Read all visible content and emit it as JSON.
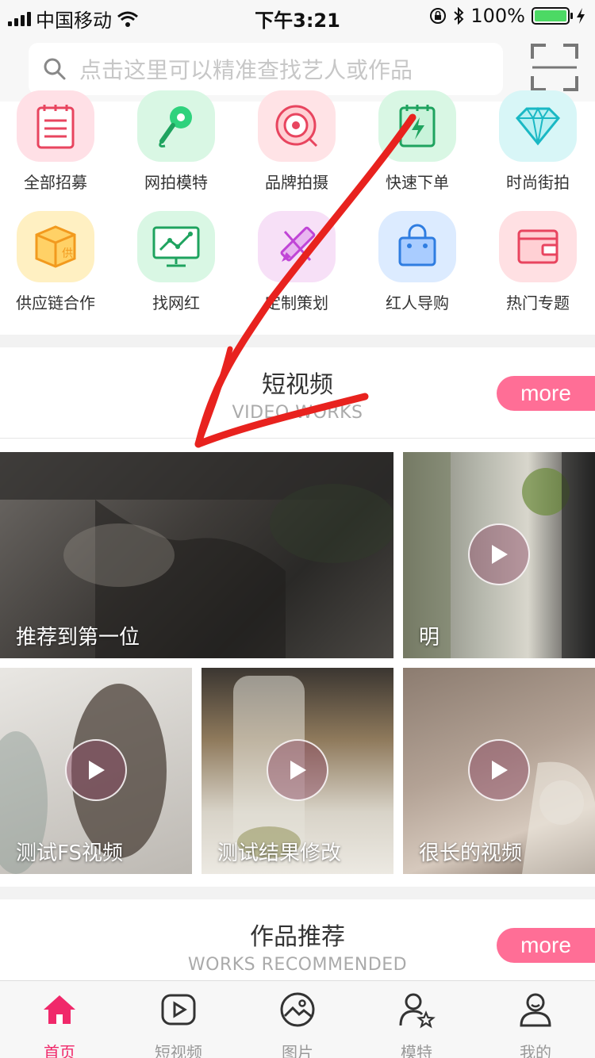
{
  "status_bar": {
    "carrier": "中国移动",
    "time": "下午3:21",
    "battery": "100%"
  },
  "search": {
    "placeholder": "点击这里可以精准查找艺人或作品"
  },
  "categories": [
    {
      "label": "全部招募",
      "icon": "recruit-icon",
      "bg": "#ffe0e6"
    },
    {
      "label": "网拍模特",
      "icon": "microphone-icon",
      "bg": "#d9f7e4"
    },
    {
      "label": "品牌拍摄",
      "icon": "camera-lens-icon",
      "bg": "#ffe3e6"
    },
    {
      "label": "快速下单",
      "icon": "quick-order-icon",
      "bg": "#d9f7e4"
    },
    {
      "label": "时尚街拍",
      "icon": "diamond-icon",
      "bg": "#d8f6f7"
    },
    {
      "label": "供应链合作",
      "icon": "supply-box-icon",
      "bg": "#fff0c2"
    },
    {
      "label": "找网红",
      "icon": "monitor-chart-icon",
      "bg": "#d9f7e4"
    },
    {
      "label": "定制策划",
      "icon": "pencil-ruler-icon",
      "bg": "#f7e0f7"
    },
    {
      "label": "红人导购",
      "icon": "shopping-bag-icon",
      "bg": "#dcebff"
    },
    {
      "label": "热门专题",
      "icon": "wallet-icon",
      "bg": "#ffe0e3"
    }
  ],
  "short_video": {
    "title": "短视频",
    "subtitle": "VIDEO WORKS",
    "more": "more",
    "items": [
      {
        "caption": "推荐到第一位"
      },
      {
        "caption": "明"
      },
      {
        "caption": "测试FS视频"
      },
      {
        "caption": "测试结果修改"
      },
      {
        "caption": "很长的视频"
      }
    ]
  },
  "works": {
    "title": "作品推荐",
    "subtitle": "WORKS RECOMMENDED",
    "more": "more"
  },
  "tabs": [
    {
      "label": "首页",
      "icon": "home-icon",
      "active": true
    },
    {
      "label": "短视频",
      "icon": "video-play-icon",
      "active": false
    },
    {
      "label": "图片",
      "icon": "picture-icon",
      "active": false
    },
    {
      "label": "模特",
      "icon": "model-star-icon",
      "active": false
    },
    {
      "label": "我的",
      "icon": "profile-icon",
      "active": false
    }
  ],
  "colors": {
    "accent": "#f0286a",
    "more_button": "#ff6e96",
    "annotation": "#e8221e"
  }
}
